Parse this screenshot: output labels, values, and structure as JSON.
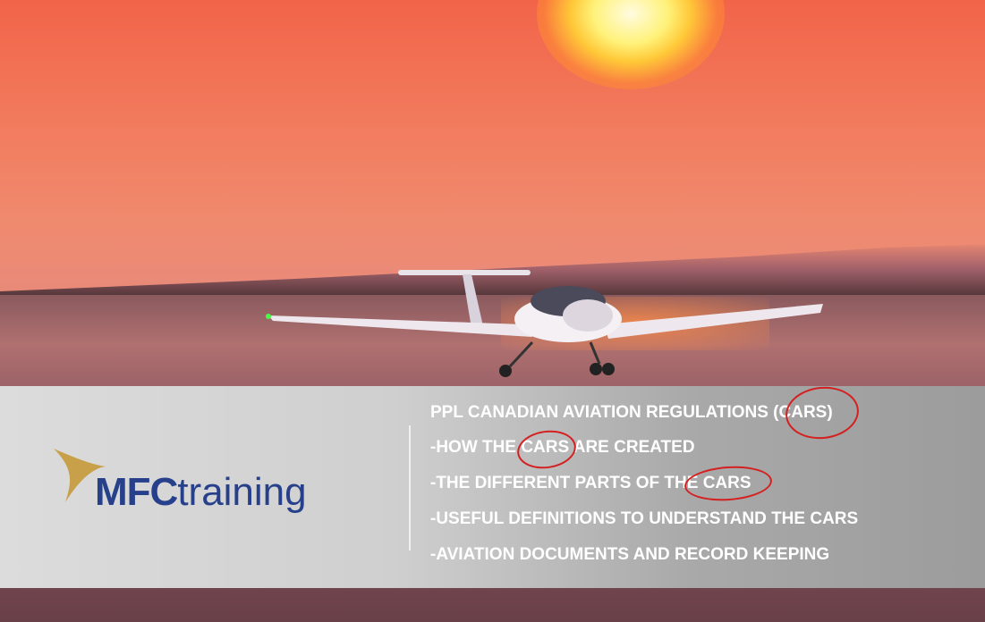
{
  "logo": {
    "brand_bold": "MFC",
    "brand_light": "training",
    "colors": {
      "navy": "#27408b",
      "gold": "#c9a04a"
    }
  },
  "topics": [
    "PPL CANADIAN AVIATION REGULATIONS (CARS)",
    "-HOW THE CARS ARE CREATED",
    "-THE DIFFERENT PARTS OF THE CARS",
    "-USEFUL DEFINITIONS TO UNDERSTAND THE CARS",
    "-AVIATION DOCUMENTS AND RECORD KEEPING"
  ],
  "annotation_color": "#d42020"
}
